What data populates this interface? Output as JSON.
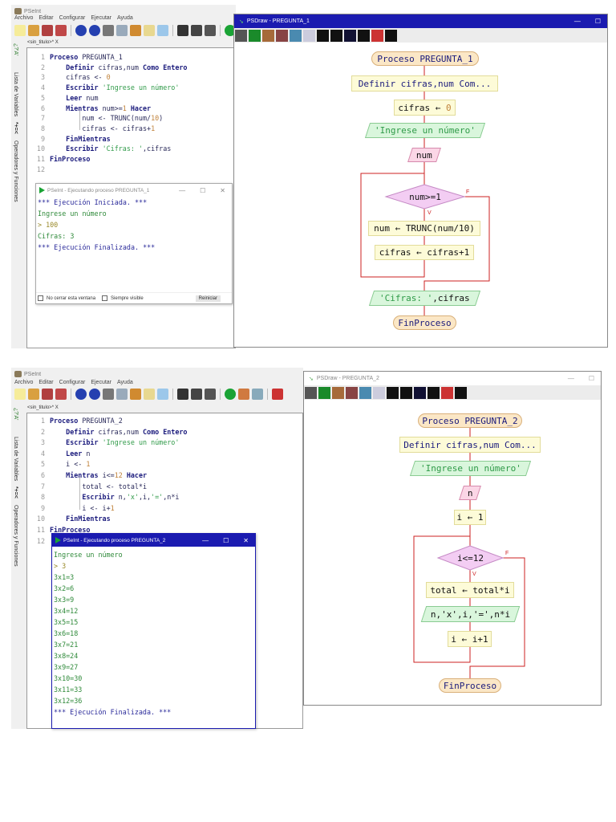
{
  "colors": {
    "accent": "#1b1bb0",
    "flow_line": "#cc2222",
    "keyword": "#1a1a7c",
    "string": "#2f9a48"
  },
  "top": {
    "app_title": "PSeInt",
    "menu": [
      "Archivo",
      "Editar",
      "Configurar",
      "Ejecutar",
      "Ayuda"
    ],
    "tab_label": "<sin_titulo>*",
    "tab_close": "X",
    "side_labels": [
      "Lista de Variables",
      "Operadores y Funciones"
    ],
    "side_symbols": [
      "*+=<",
      "¿?'A'"
    ],
    "code": [
      [
        {
          "t": "Proceso ",
          "c": "kw"
        },
        {
          "t": "PREGUNTA_1",
          "c": "id"
        }
      ],
      [
        {
          "t": "    Definir ",
          "c": "kw"
        },
        {
          "t": "cifras,num ",
          "c": "id"
        },
        {
          "t": "Como Entero",
          "c": "kw"
        }
      ],
      [
        {
          "t": "    cifras <- ",
          "c": "id"
        },
        {
          "t": "0",
          "c": "num"
        }
      ],
      [
        {
          "t": "    Escribir ",
          "c": "kw"
        },
        {
          "t": "'Ingrese un número'",
          "c": "str"
        }
      ],
      [
        {
          "t": "    Leer ",
          "c": "kw"
        },
        {
          "t": "num",
          "c": "id"
        }
      ],
      [
        {
          "t": "    Mientras ",
          "c": "kw"
        },
        {
          "t": "num>=",
          "c": "id"
        },
        {
          "t": "1",
          "c": "num"
        },
        {
          "t": " Hacer",
          "c": "kw"
        }
      ],
      [
        {
          "t": "        num <- TRUNC(num/",
          "c": "id"
        },
        {
          "t": "10",
          "c": "num"
        },
        {
          "t": ")",
          "c": "id"
        }
      ],
      [
        {
          "t": "        cifras <- cifras+",
          "c": "id"
        },
        {
          "t": "1",
          "c": "num"
        }
      ],
      [
        {
          "t": "    FinMientras",
          "c": "kw"
        }
      ],
      [
        {
          "t": "    Escribir ",
          "c": "kw"
        },
        {
          "t": "'Cifras: '",
          "c": "str"
        },
        {
          "t": ",cifras",
          "c": "id"
        }
      ],
      [
        {
          "t": "FinProceso",
          "c": "kw"
        }
      ],
      []
    ],
    "console": {
      "title": "PSeInt - Ejecutando proceso PREGUNTA_1",
      "lines": [
        {
          "t": "*** Ejecución Iniciada. ***",
          "c": "c-blue"
        },
        {
          "t": "Ingrese un número",
          "c": "c-green"
        },
        {
          "t": "> 100",
          "c": "c-olive"
        },
        {
          "t": "Cifras: 3",
          "c": "c-green"
        },
        {
          "t": "*** Ejecución Finalizada. ***",
          "c": "c-blue"
        }
      ],
      "no_close_label": "No cerrar esta ventana",
      "always_visible_label": "Siempre visible",
      "restart_label": "Reiniciar"
    },
    "psdraw": {
      "title": "PSDraw - PREGUNTA_1",
      "nodes": {
        "start": "Proceso PREGUNTA_1",
        "define": "Definir cifras,num Com...",
        "assign_var": "cifras",
        "assign_val": "0",
        "write": "'Ingrese un número'",
        "read": "num",
        "cond": "num>=1",
        "body1": "num ← TRUNC(num/10)",
        "body2": "cifras ← cifras+1",
        "out_str": "'Cifras: '",
        "out_var": ",cifras",
        "end": "FinProceso",
        "true_label": "V",
        "false_label": "F"
      }
    }
  },
  "bottom": {
    "app_title": "PSeInt",
    "menu": [
      "Archivo",
      "Editar",
      "Configurar",
      "Ejecutar",
      "Ayuda"
    ],
    "tab_label": "<sin_titulo>*",
    "tab_close": "X",
    "side_labels": [
      "Lista de Variables",
      "Operadores y Funciones"
    ],
    "side_symbols": [
      "*+=<",
      "¿?'A'"
    ],
    "code": [
      [
        {
          "t": "Proceso ",
          "c": "kw"
        },
        {
          "t": "PREGUNTA_2",
          "c": "id"
        }
      ],
      [
        {
          "t": "    Definir ",
          "c": "kw"
        },
        {
          "t": "cifras,num ",
          "c": "id"
        },
        {
          "t": "Como Entero",
          "c": "kw"
        }
      ],
      [
        {
          "t": "    Escribir ",
          "c": "kw"
        },
        {
          "t": "'Ingrese un número'",
          "c": "str"
        }
      ],
      [
        {
          "t": "    Leer ",
          "c": "kw"
        },
        {
          "t": "n",
          "c": "id"
        }
      ],
      [
        {
          "t": "    i <- ",
          "c": "id"
        },
        {
          "t": "1",
          "c": "num"
        }
      ],
      [
        {
          "t": "    Mientras ",
          "c": "kw"
        },
        {
          "t": "i<=",
          "c": "id"
        },
        {
          "t": "12",
          "c": "num"
        },
        {
          "t": " Hacer",
          "c": "kw"
        }
      ],
      [
        {
          "t": "        total <- total*i",
          "c": "id"
        }
      ],
      [
        {
          "t": "        Escribir ",
          "c": "kw"
        },
        {
          "t": "n,",
          "c": "id"
        },
        {
          "t": "'x'",
          "c": "str"
        },
        {
          "t": ",i,",
          "c": "id"
        },
        {
          "t": "'='",
          "c": "str"
        },
        {
          "t": ",n*i",
          "c": "id"
        }
      ],
      [
        {
          "t": "        i <- i+",
          "c": "id"
        },
        {
          "t": "1",
          "c": "num"
        }
      ],
      [
        {
          "t": "    FinMientras",
          "c": "kw"
        }
      ],
      [
        {
          "t": "FinProceso",
          "c": "kw"
        }
      ],
      []
    ],
    "console": {
      "title": "PSeInt - Ejecutando proceso PREGUNTA_2",
      "lines": [
        {
          "t": "Ingrese un número",
          "c": "c-green"
        },
        {
          "t": "> 3",
          "c": "c-olive"
        },
        {
          "t": "3x1=3",
          "c": "c-green"
        },
        {
          "t": "3x2=6",
          "c": "c-green"
        },
        {
          "t": "3x3=9",
          "c": "c-green"
        },
        {
          "t": "3x4=12",
          "c": "c-green"
        },
        {
          "t": "3x5=15",
          "c": "c-green"
        },
        {
          "t": "3x6=18",
          "c": "c-green"
        },
        {
          "t": "3x7=21",
          "c": "c-green"
        },
        {
          "t": "3x8=24",
          "c": "c-green"
        },
        {
          "t": "3x9=27",
          "c": "c-green"
        },
        {
          "t": "3x10=30",
          "c": "c-green"
        },
        {
          "t": "3x11=33",
          "c": "c-green"
        },
        {
          "t": "3x12=36",
          "c": "c-green"
        },
        {
          "t": "*** Ejecución Finalizada. ***",
          "c": "c-blue"
        }
      ]
    },
    "psdraw": {
      "title": "PSDraw - PREGUNTA_2",
      "nodes": {
        "start": "Proceso PREGUNTA_2",
        "define": "Definir cifras,num Com...",
        "write": "'Ingrese un número'",
        "read": "n",
        "init": "i ← 1",
        "cond": "i<=12",
        "body1": "total ← total*i",
        "body2": "n,'x',i,'=',n*i",
        "body3": "i ← i+1",
        "end": "FinProceso",
        "true_label": "V",
        "false_label": "F"
      }
    }
  }
}
